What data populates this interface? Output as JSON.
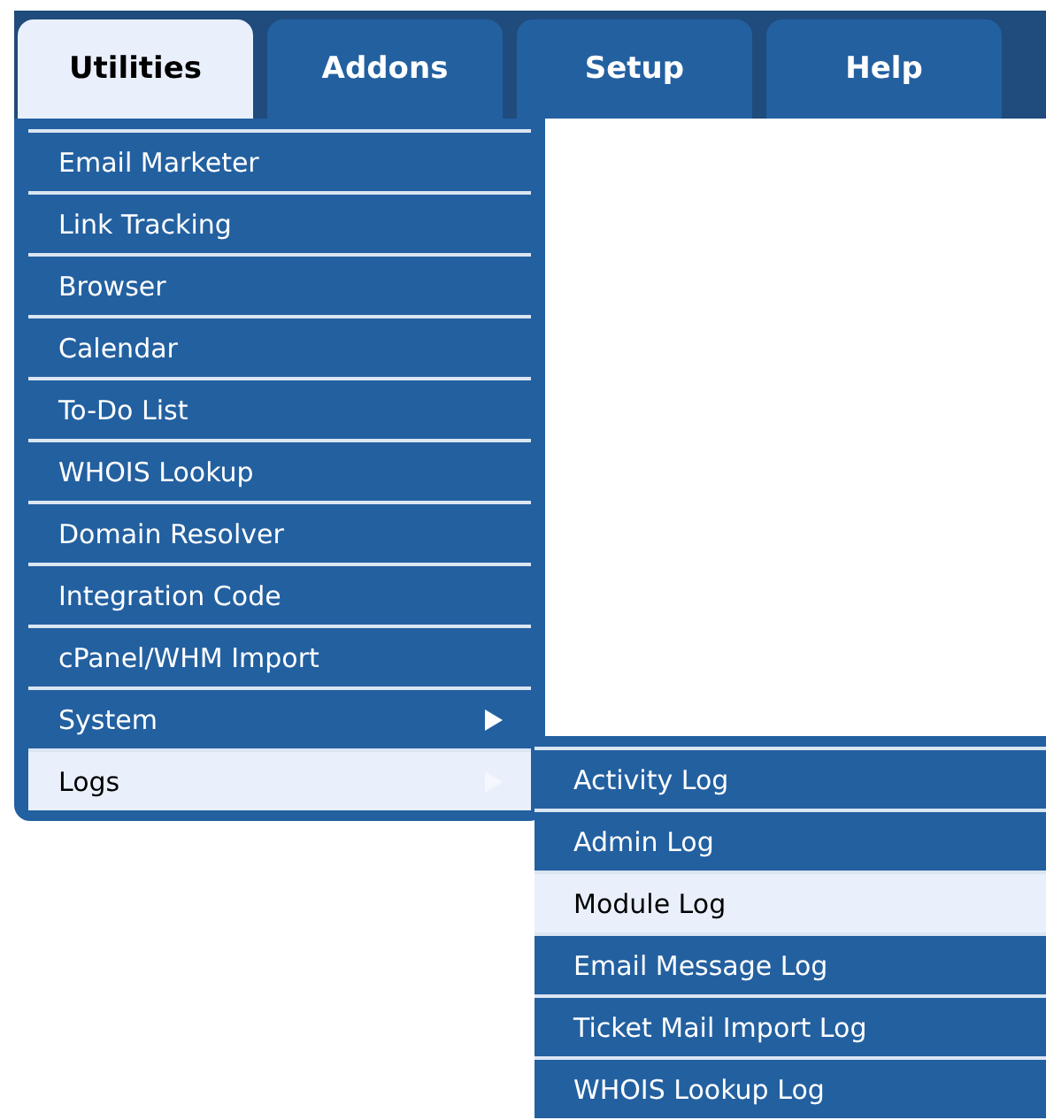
{
  "tabs": [
    {
      "label": "Utilities",
      "selected": true
    },
    {
      "label": "Addons",
      "selected": false
    },
    {
      "label": "Setup",
      "selected": false
    },
    {
      "label": "Help",
      "selected": false
    }
  ],
  "menu": {
    "items": [
      {
        "label": "Email Marketer",
        "kind": "plain",
        "selected": false
      },
      {
        "label": "Link Tracking",
        "kind": "plain",
        "selected": false
      },
      {
        "label": "Browser",
        "kind": "plain",
        "selected": false
      },
      {
        "label": "Calendar",
        "kind": "plain",
        "selected": false
      },
      {
        "label": "To-Do List",
        "kind": "plain",
        "selected": false
      },
      {
        "label": "WHOIS Lookup",
        "kind": "plain",
        "selected": false
      },
      {
        "label": "Domain Resolver",
        "kind": "plain",
        "selected": false
      },
      {
        "label": "Integration Code",
        "kind": "plain",
        "selected": false
      },
      {
        "label": "cPanel/WHM Import",
        "kind": "plain",
        "selected": false
      },
      {
        "label": "System",
        "kind": "submenu",
        "selected": false
      },
      {
        "label": "Logs",
        "kind": "submenu",
        "selected": true,
        "children": [
          {
            "label": "Activity Log",
            "selected": false
          },
          {
            "label": "Admin Log",
            "selected": false
          },
          {
            "label": "Module Log",
            "selected": true
          },
          {
            "label": "Email Message Log",
            "selected": false
          },
          {
            "label": "Ticket Mail Import Log",
            "selected": false
          },
          {
            "label": "WHOIS Lookup Log",
            "selected": false
          }
        ]
      }
    ]
  }
}
